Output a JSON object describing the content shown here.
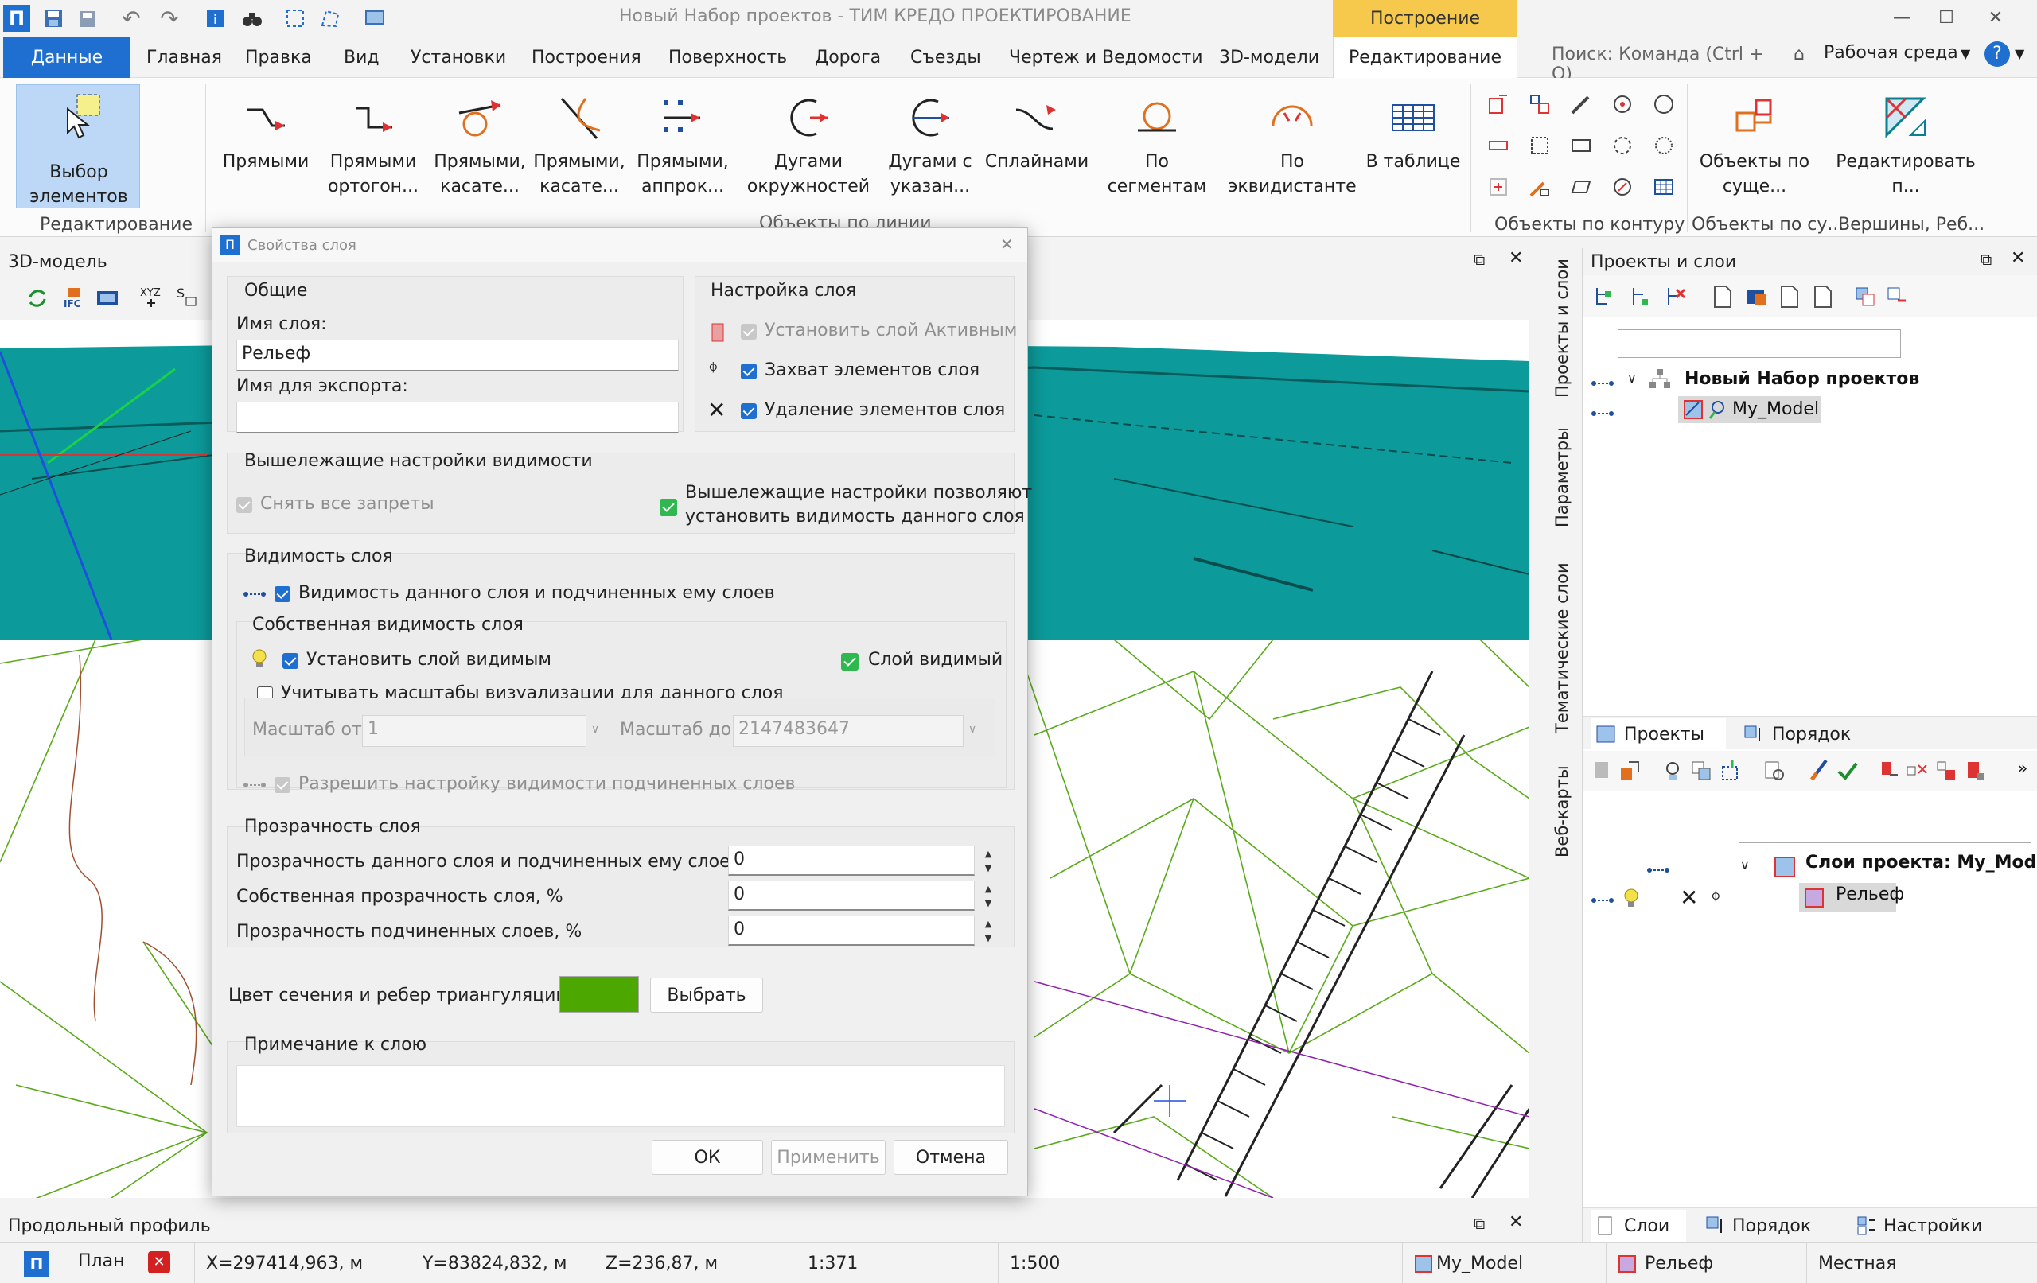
{
  "app": {
    "title": "Новый Набор проектов - ТИМ КРЕДО ПРОЕКТИРОВАНИЕ",
    "context_tab": "Построение",
    "logo_letter": "П"
  },
  "menu": {
    "tabs": [
      "Данные",
      "Главная",
      "Правка",
      "Вид",
      "Установки",
      "Построения",
      "Поверхность",
      "Дорога",
      "Съезды",
      "Чертеж и Ведомости",
      "3D-модели",
      "Редактирование"
    ],
    "search_placeholder": "Поиск: Команда (Ctrl + Q)",
    "workspace_label": "Рабочая среда"
  },
  "ribbon": {
    "select": {
      "line1": "Выбор",
      "line2": "элементов"
    },
    "group_edit": "Редактирование",
    "buttons": [
      {
        "line1": "Прямыми",
        "line2": ""
      },
      {
        "line1": "Прямыми",
        "line2": "ортогон..."
      },
      {
        "line1": "Прямыми,",
        "line2": "касате..."
      },
      {
        "line1": "Прямыми,",
        "line2": "касате..."
      },
      {
        "line1": "Прямыми,",
        "line2": "аппрок..."
      },
      {
        "line1": "Дугами",
        "line2": "окружностей"
      },
      {
        "line1": "Дугами с",
        "line2": "указан..."
      },
      {
        "line1": "Сплайнами",
        "line2": ""
      },
      {
        "line1": "По сегментам",
        "line2": ""
      },
      {
        "line1": "По эквидистанте",
        "line2": ""
      },
      {
        "line1": "В таблице",
        "line2": ""
      }
    ],
    "group_by_lines": "Объекты по линии",
    "group_by_contour": "Объекты по контуру",
    "objects_existing": {
      "line1": "Объекты по",
      "line2": "суще..."
    },
    "group_objects_existing": "Объекты по су...",
    "edit_vertices": {
      "line1": "Редактировать",
      "line2": "п..."
    },
    "group_vertices": "Вершины, Реб..."
  },
  "panels": {
    "model3d_title": "3D-модель",
    "profile_title": "Продольный профиль",
    "projects_title": "Проекты и слои",
    "vertical_tabs": [
      "Проекты и слои",
      "Параметры",
      "Тематические слои",
      "Веб-карты"
    ],
    "project_tabs": [
      "Проекты",
      "Порядок"
    ],
    "bottom_tabs": [
      "Слои",
      "Порядок",
      "Настройки"
    ],
    "tree": {
      "root": "Новый Набор проектов",
      "model": "My_Model",
      "layers_root": "Слои проекта: My_Model",
      "layer": "Рельеф"
    }
  },
  "dialog": {
    "title": "Свойства слоя",
    "general": {
      "title": "Общие",
      "layer_name_label": "Имя слоя:",
      "layer_name_value": "Рельеф",
      "export_name_label": "Имя для экспорта:",
      "export_name_value": ""
    },
    "layer_settings": {
      "title": "Настройка слоя",
      "set_active": "Установить слой Активным",
      "capture": "Захват элементов слоя",
      "delete": "Удаление элементов слоя"
    },
    "upper_visibility": {
      "title": "Вышележащие настройки видимости",
      "remove_bans": "Снять все запреты",
      "allow_line1": "Вышележащие настройки позволяют",
      "allow_line2": "установить видимость данного слоя"
    },
    "layer_visibility": {
      "title": "Видимость слоя",
      "visibility_sub": "Видимость данного слоя и подчиненных ему слоев",
      "own_title": "Собственная видимость слоя",
      "set_visible": "Установить слой видимым",
      "layer_visible": "Слой видимый",
      "consider_scales": "Учитывать масштабы визуализации для данного слоя",
      "scale_from_label": "Масштаб от:",
      "scale_from": "1",
      "scale_to_label": "Масштаб до:",
      "scale_to": "2147483647",
      "allow_sub": "Разрешить настройку видимости подчиненных слоев"
    },
    "transparency": {
      "title": "Прозрачность слоя",
      "rows": [
        {
          "label": "Прозрачность данного слоя и подчиненных ему слоев, %",
          "value": "0"
        },
        {
          "label": "Собственная прозрачность слоя, %",
          "value": "0"
        },
        {
          "label": "Прозрачность подчиненных слоев, %",
          "value": "0"
        }
      ]
    },
    "color": {
      "label": "Цвет сечения и ребер триангуляции:",
      "swatch": "#4ca800",
      "choose": "Выбрать"
    },
    "note": {
      "title": "Примечание к слою",
      "value": ""
    },
    "buttons": {
      "ok": "ОК",
      "apply": "Применить",
      "cancel": "Отмена"
    }
  },
  "status": {
    "mode": "План",
    "x": "X=297414,963, м",
    "y": "Y=83824,832, м",
    "z": "Z=236,87, м",
    "scale1": "1:371",
    "scale2": "1:500",
    "model": "My_Model",
    "layer": "Рельеф",
    "coord_system": "Местная"
  },
  "colors": {
    "accent": "#1f6fd1",
    "context_tab": "#f6c94d",
    "terrain": "#0c9a9a",
    "triangulation": "#4ca800"
  }
}
